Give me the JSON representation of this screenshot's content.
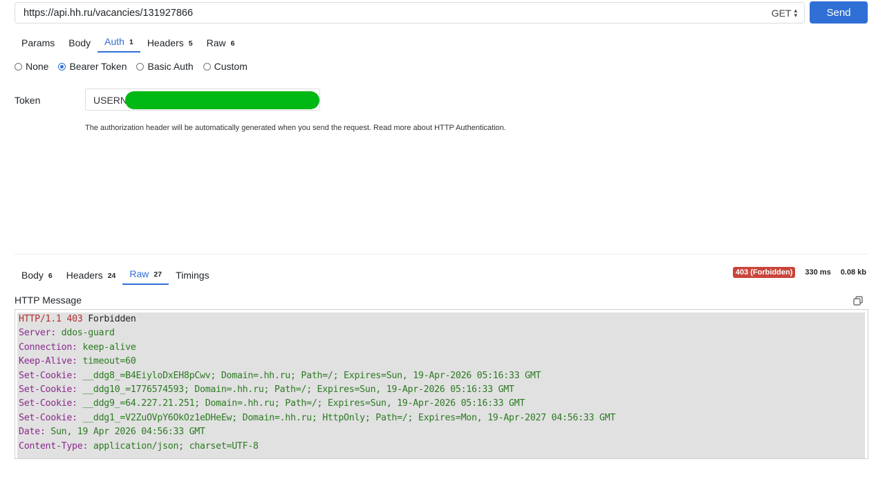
{
  "request": {
    "url": "https://api.hh.ru/vacancies/131927866",
    "method": "GET",
    "send_label": "Send",
    "tabs": [
      {
        "label": "Params",
        "count": ""
      },
      {
        "label": "Body",
        "count": ""
      },
      {
        "label": "Auth",
        "count": "1"
      },
      {
        "label": "Headers",
        "count": "5"
      },
      {
        "label": "Raw",
        "count": "6"
      }
    ]
  },
  "auth": {
    "options": [
      "None",
      "Bearer Token",
      "Basic Auth",
      "Custom"
    ],
    "selected": "Bearer Token",
    "token_label": "Token",
    "token_value": "USERN",
    "hint": "The authorization header will be automatically generated when you send the request. Read more about HTTP Authentication."
  },
  "response": {
    "tabs": [
      {
        "label": "Body",
        "count": "6"
      },
      {
        "label": "Headers",
        "count": "24"
      },
      {
        "label": "Raw",
        "count": "27"
      },
      {
        "label": "Timings",
        "count": ""
      }
    ],
    "status": "403 (Forbidden)",
    "time": "330 ms",
    "size": "0.08 kb",
    "message_title": "HTTP Message",
    "status_line": {
      "protocol": "HTTP/1.1",
      "code": "403",
      "text": "Forbidden"
    },
    "headers": [
      {
        "name": "Server:",
        "value": "ddos-guard"
      },
      {
        "name": "Connection:",
        "value": "keep-alive"
      },
      {
        "name": "Keep-Alive:",
        "value": "timeout=60"
      },
      {
        "name": "Set-Cookie:",
        "value": "__ddg8_=B4EiyloDxEH8pCwv; Domain=.hh.ru; Path=/; Expires=Sun, 19-Apr-2026 05:16:33 GMT"
      },
      {
        "name": "Set-Cookie:",
        "value": "__ddg10_=1776574593; Domain=.hh.ru; Path=/; Expires=Sun, 19-Apr-2026 05:16:33 GMT"
      },
      {
        "name": "Set-Cookie:",
        "value": "__ddg9_=64.227.21.251; Domain=.hh.ru; Path=/; Expires=Sun, 19-Apr-2026 05:16:33 GMT"
      },
      {
        "name": "Set-Cookie:",
        "value": "__ddg1_=V2ZuOVpY6OkOz1eDHeEw; Domain=.hh.ru; HttpOnly; Path=/; Expires=Mon, 19-Apr-2027 04:56:33 GMT"
      },
      {
        "name": "Date:",
        "value": "Sun, 19 Apr 2026 04:56:33 GMT"
      },
      {
        "name": "Content-Type:",
        "value": "application/json; charset=UTF-8"
      }
    ]
  }
}
